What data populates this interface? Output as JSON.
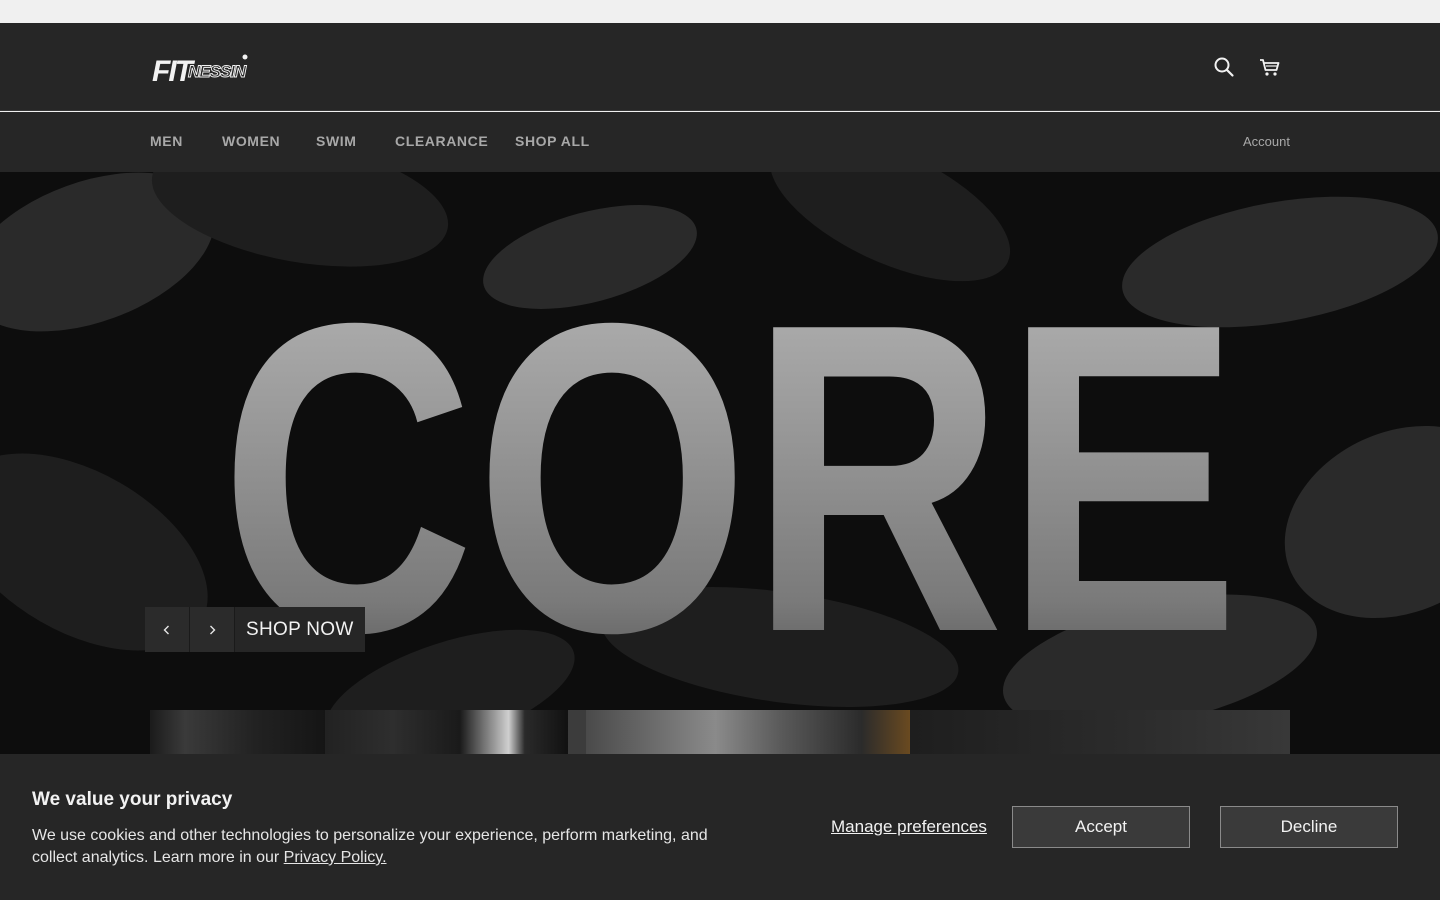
{
  "brand": {
    "logo_text": "FITNESSIN'"
  },
  "header": {
    "search_icon": "search-icon",
    "cart_icon": "cart-icon"
  },
  "nav": {
    "items": [
      {
        "label": "MEN"
      },
      {
        "label": "WOMEN"
      },
      {
        "label": "SWIM"
      },
      {
        "label": "CLEARANCE"
      },
      {
        "label": "SHOP ALL"
      }
    ],
    "account": "Account"
  },
  "hero": {
    "headline": "CORE",
    "prev_icon": "chevron-left-icon",
    "next_icon": "chevron-right-icon",
    "cta": "SHOP NOW"
  },
  "cookie": {
    "title": "We value your privacy",
    "text": "We use cookies and other technologies to personalize your experience, perform marketing, and collect analytics. Learn more in our ",
    "link": "Privacy Policy.",
    "manage": "Manage preferences",
    "accept": "Accept",
    "decline": "Decline"
  },
  "colors": {
    "header_bg": "#262626",
    "nav_text": "#a8a8a8",
    "hero_bg": "#0d0d0d",
    "banner_bg": "#262626"
  }
}
